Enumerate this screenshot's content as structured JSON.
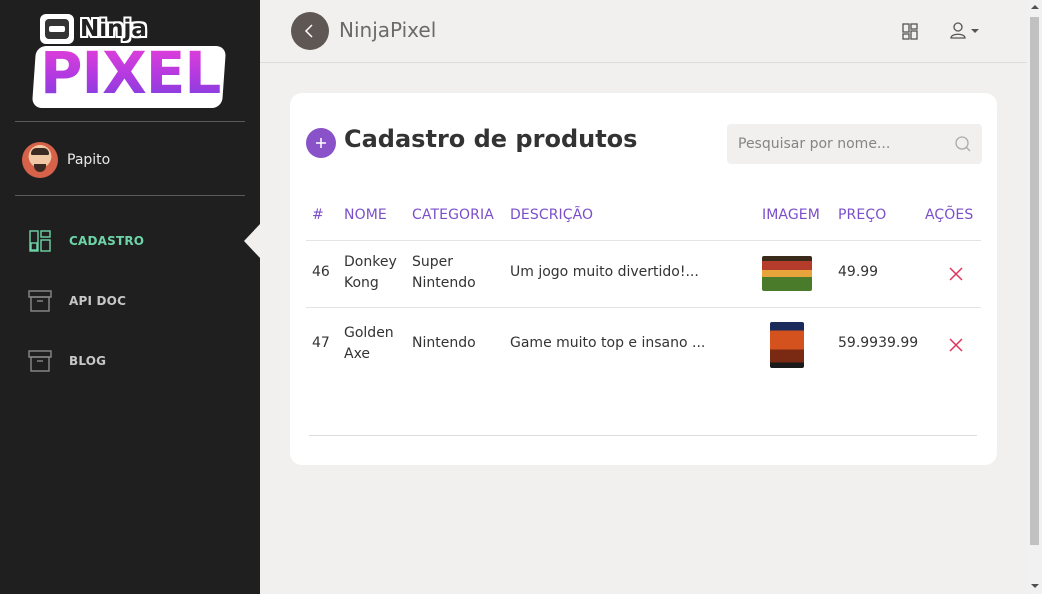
{
  "brand": {
    "logo_top": "Ninja",
    "logo_bottom": "PIXEL"
  },
  "user": {
    "name": "Papito"
  },
  "sidebar": {
    "items": [
      {
        "label": "CADASTRO",
        "icon": "dashboard-icon",
        "active": true
      },
      {
        "label": "API DOC",
        "icon": "archive-box-icon",
        "active": false
      },
      {
        "label": "BLOG",
        "icon": "archive-box-icon",
        "active": false
      }
    ]
  },
  "header": {
    "title": "NinjaPixel",
    "back_icon": "chevron-left-icon",
    "grid_icon": "grid-icon",
    "user_icon": "user-icon"
  },
  "card": {
    "title": "Cadastro de produtos",
    "add_icon": "plus-icon",
    "search": {
      "placeholder": "Pesquisar por nome...",
      "value": ""
    }
  },
  "table": {
    "columns": [
      "#",
      "NOME",
      "CATEGORIA",
      "DESCRIÇÃO",
      "IMAGEM",
      "PREÇO",
      "AÇÕES"
    ],
    "rows": [
      {
        "id": "46",
        "name_line1": "Donkey",
        "name_line2": "Kong",
        "cat_line1": "Super",
        "cat_line2": "Nintendo",
        "description": "Um jogo muito divertido!...",
        "image": "donkey-kong-cover",
        "price": "49.99"
      },
      {
        "id": "47",
        "name_line1": "Golden",
        "name_line2": "Axe",
        "cat_line1": "Nintendo",
        "cat_line2": "",
        "description": "Game muito top e insano ...",
        "image": "golden-axe-cover",
        "price": "59.9939.99"
      }
    ]
  },
  "colors": {
    "accent": "#7b4fc9",
    "active_nav": "#6ed4a8",
    "danger": "#e0325a",
    "sidebar_bg": "#1f1f1f"
  }
}
